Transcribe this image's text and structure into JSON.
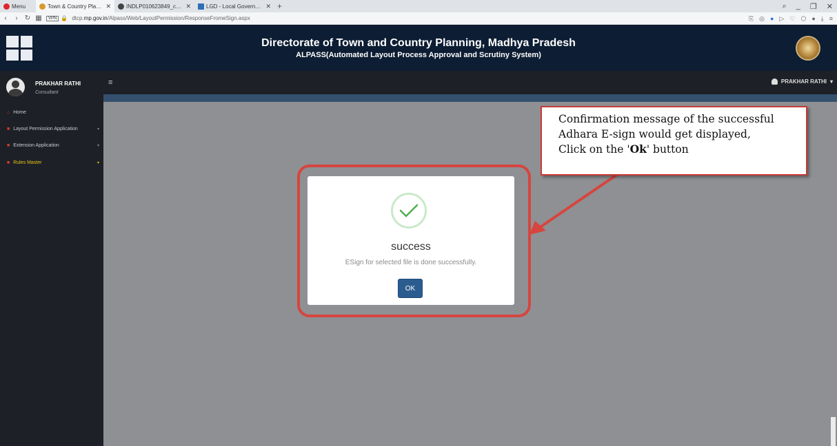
{
  "browser": {
    "menu_label": "Menu",
    "tabs": [
      {
        "title": "Town & Country Planning"
      },
      {
        "title": "INDLP010623849_c22cf95"
      },
      {
        "title": "LGD - Local Government D"
      }
    ],
    "url_prefix": "dtcp.",
    "url_domain": "mp.gov.in",
    "url_path": "/Alpass/Web/LayoutPermission/ResponseFromeSign.aspx",
    "vpn_label": "VPN"
  },
  "header": {
    "title": "Directorate of Town and Country Planning, Madhya Pradesh",
    "subtitle": "ALPASS(Automated Layout Process Approval and Scrutiny System)"
  },
  "sidebar": {
    "user_name": "PRAKHAR RATHI",
    "user_role": "Consultant",
    "items": [
      {
        "label": "Home"
      },
      {
        "label": "Layout Permission Application"
      },
      {
        "label": "Extension Application"
      },
      {
        "label": "Rules Master"
      }
    ]
  },
  "topbar": {
    "user_name": "PRAKHAR RATHI"
  },
  "dialog": {
    "title": "success",
    "message": "ESign for selected file is done successfully.",
    "ok_label": "OK"
  },
  "annotation": {
    "line1": "Confirmation message of the successful",
    "line2": "Adhara E-sign would get displayed,",
    "line3_pre": "Click on the '",
    "line3_bold": "Ok",
    "line3_post": "' button"
  },
  "colors": {
    "header_bg": "#0d1d33",
    "sidebar_bg": "#1d2026",
    "ok_button": "#2b5c8f",
    "highlight_red": "#d6453e",
    "success_green": "#4caf50"
  }
}
